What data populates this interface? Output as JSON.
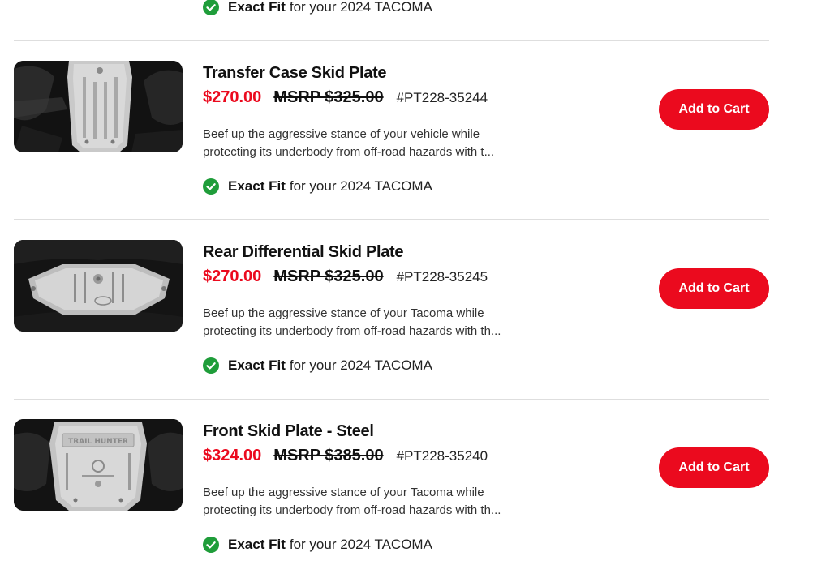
{
  "colors": {
    "accent": "#eb0a1e",
    "check": "#1f9d3a",
    "divider": "#dedede"
  },
  "top_fit": {
    "strong": "Exact Fit",
    "text": "for your 2024 TACOMA"
  },
  "products": [
    {
      "title": "Transfer Case Skid Plate",
      "price": "$270.00",
      "msrp": "MSRP $325.00",
      "part_number": "#PT228-35244",
      "desc_line1": "Beef up the aggressive stance of your vehicle while",
      "desc_line2": "protecting its underbody from off-road hazards with t...",
      "fit_strong": "Exact Fit",
      "fit_text": "for your 2024 TACOMA",
      "cart_label": "Add to Cart",
      "image_icon": "transfer-case-skid-plate-image"
    },
    {
      "title": "Rear Differential Skid Plate",
      "price": "$270.00",
      "msrp": "MSRP $325.00",
      "part_number": "#PT228-35245",
      "desc_line1": "Beef up the aggressive stance of your Tacoma while",
      "desc_line2": "protecting its underbody from off-road hazards with th...",
      "fit_strong": "Exact Fit",
      "fit_text": "for your 2024 TACOMA",
      "cart_label": "Add to Cart",
      "image_icon": "rear-differential-skid-plate-image"
    },
    {
      "title": "Front Skid Plate - Steel",
      "price": "$324.00",
      "msrp": "MSRP $385.00",
      "part_number": "#PT228-35240",
      "desc_line1": "Beef up the aggressive stance of your Tacoma while",
      "desc_line2": "protecting its underbody from off-road hazards with th...",
      "fit_strong": "Exact Fit",
      "fit_text": "for your 2024 TACOMA",
      "cart_label": "Add to Cart",
      "image_icon": "front-skid-plate-image",
      "image_text": "TRAIL HUNTER"
    }
  ]
}
